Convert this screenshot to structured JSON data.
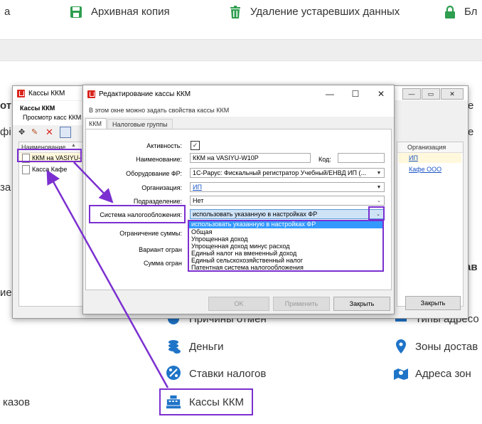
{
  "background": {
    "top_left_fragment": "а",
    "top_items": [
      {
        "label": "Архивная копия",
        "icon": "floppy-icon"
      },
      {
        "label": "Удаление устаревших данных",
        "icon": "trash-icon"
      },
      {
        "label": "Бл",
        "icon": "lock-icon"
      }
    ],
    "left_fragments": [
      "от",
      "фі",
      "за",
      "ие",
      "казов"
    ],
    "right_fragments": [
      "е",
      "е",
      "ав"
    ],
    "menu_items": [
      {
        "label": "Причины отмен",
        "icon": "cancel-reasons-icon"
      },
      {
        "label": "Деньги",
        "icon": "coins-icon"
      },
      {
        "label": "Ставки налогов",
        "icon": "percent-icon"
      },
      {
        "label": "Кассы ККМ",
        "icon": "cash-register-icon"
      }
    ],
    "menu_items_right": [
      {
        "label": "Типы адресо",
        "icon": "address-types-icon"
      },
      {
        "label": "Зоны достав",
        "icon": "zones-icon"
      },
      {
        "label": "Адреса зон",
        "icon": "address-zones-icon"
      }
    ]
  },
  "list_window": {
    "title": "Кассы ККМ",
    "header": "Кассы ККМ",
    "subheader": "Просмотр касс ККМ",
    "columns": {
      "name": "Наименование",
      "org": "Организация"
    },
    "rows": [
      {
        "name": "ККМ на VASIYU-",
        "org": "ИП"
      },
      {
        "name": "Касса Кафе",
        "org": "Кафе ООО"
      }
    ],
    "close_button": "Закрыть"
  },
  "edit_window": {
    "title": "Редактирование кассы ККМ",
    "description": "В этом окне можно задать свойства кассы ККМ",
    "tabs": [
      "ККМ",
      "Налоговые группы"
    ],
    "labels": {
      "active": "Активность:",
      "name": "Наименование:",
      "code": "Код:",
      "equipment": "Оборудование ФР:",
      "organization": "Организация:",
      "division": "Подразделение:",
      "tax_system": "Система налогообложения:",
      "sum_limit": "Ограничение суммы:",
      "variant": "Вариант огран",
      "sum": "Сумма огран"
    },
    "values": {
      "name": "ККМ на VASIYU-W10P",
      "code": "",
      "equipment": "1С-Рарус: Фискальный регистратор Учебный/ЕНВД ИП (...",
      "organization": "ИП",
      "division": "Нет",
      "tax_system": "использовать указанную в настройках ФР"
    },
    "tax_options": [
      "использовать указанную в настройках ФР",
      "Общая",
      "Упрощенная доход",
      "Упрощенная доход минус расход",
      "Единый налог на вмененный доход",
      "Единый сельскохозяйственный налог",
      "Патентная система налогообложения"
    ],
    "buttons": {
      "ok": "OK",
      "apply": "Применить",
      "close": "Закрыть"
    }
  },
  "colors": {
    "annotation": "#7b2fd0",
    "link": "#1a55c7",
    "brand_green": "#2e9e4f",
    "brand_blue": "#1f74c8"
  }
}
